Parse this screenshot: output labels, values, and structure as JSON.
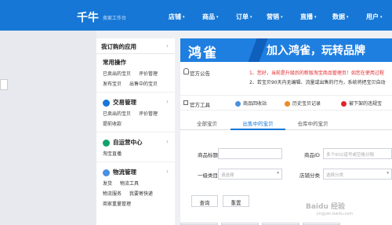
{
  "topbar": {
    "logo": "千牛",
    "sublogo": "卖家工作台",
    "nav": [
      {
        "label": "店铺"
      },
      {
        "label": "商品"
      },
      {
        "label": "订单"
      },
      {
        "label": "营销"
      },
      {
        "label": "直播"
      },
      {
        "label": "数据"
      },
      {
        "label": "用户"
      }
    ],
    "caret": "▾"
  },
  "sidebar": {
    "header": "我订购的应用",
    "chevron": "›",
    "common": {
      "title": "常用操作",
      "rows": [
        [
          "已卖出的宝贝",
          "评价管理"
        ],
        [
          "发布宝贝",
          "出售中的宝贝"
        ]
      ]
    },
    "groups": [
      {
        "title": "交易管理",
        "items": [
          [
            "已卖出的宝贝",
            "评价管理"
          ],
          [
            "提前收款"
          ]
        ]
      },
      {
        "title": "自运营中心",
        "items": [
          [
            "淘宝直播"
          ]
        ]
      },
      {
        "title": "物流管理",
        "items": [
          [
            "发货",
            "物流工具"
          ],
          [
            "物流服务",
            "我要寄快递"
          ],
          [
            "商家重量管理"
          ]
        ]
      }
    ]
  },
  "banner": {
    "brand": "鸿雀",
    "slogan": "加入鸿雀，玩转品牌"
  },
  "notice": {
    "title": "官方公告",
    "line1": "1、您好，当前是升级后的新版淘宝商品管理页！如您在使用过程",
    "line2": "2、若宝贝90天内无编辑、流量或出售的行为，系统将把宝贝自动"
  },
  "tools": {
    "title": "官方工具",
    "items": [
      {
        "label": "商品回收站",
        "color": "#4a90e2"
      },
      {
        "label": "历史宝贝记录",
        "color": "#f08a24"
      },
      {
        "label": "被下架的违规宝",
        "color": "#e0242b"
      }
    ]
  },
  "tabs": [
    "全部宝贝",
    "出售中的宝贝",
    "仓库中的宝贝"
  ],
  "form": {
    "title_label": "商品标题",
    "id_label": "商品ID",
    "id_placeholder": "多个ID以逗号或空格分隔",
    "category_label": "一级类目",
    "category_placeholder": "请选择",
    "shopcat_label": "店铺分类",
    "shopcat_placeholder": "选择分类",
    "query_button": "查询",
    "reset_button": "重置"
  },
  "watermark": {
    "main": "Baidu 经验",
    "sub": "jingyan.baidu.com"
  }
}
